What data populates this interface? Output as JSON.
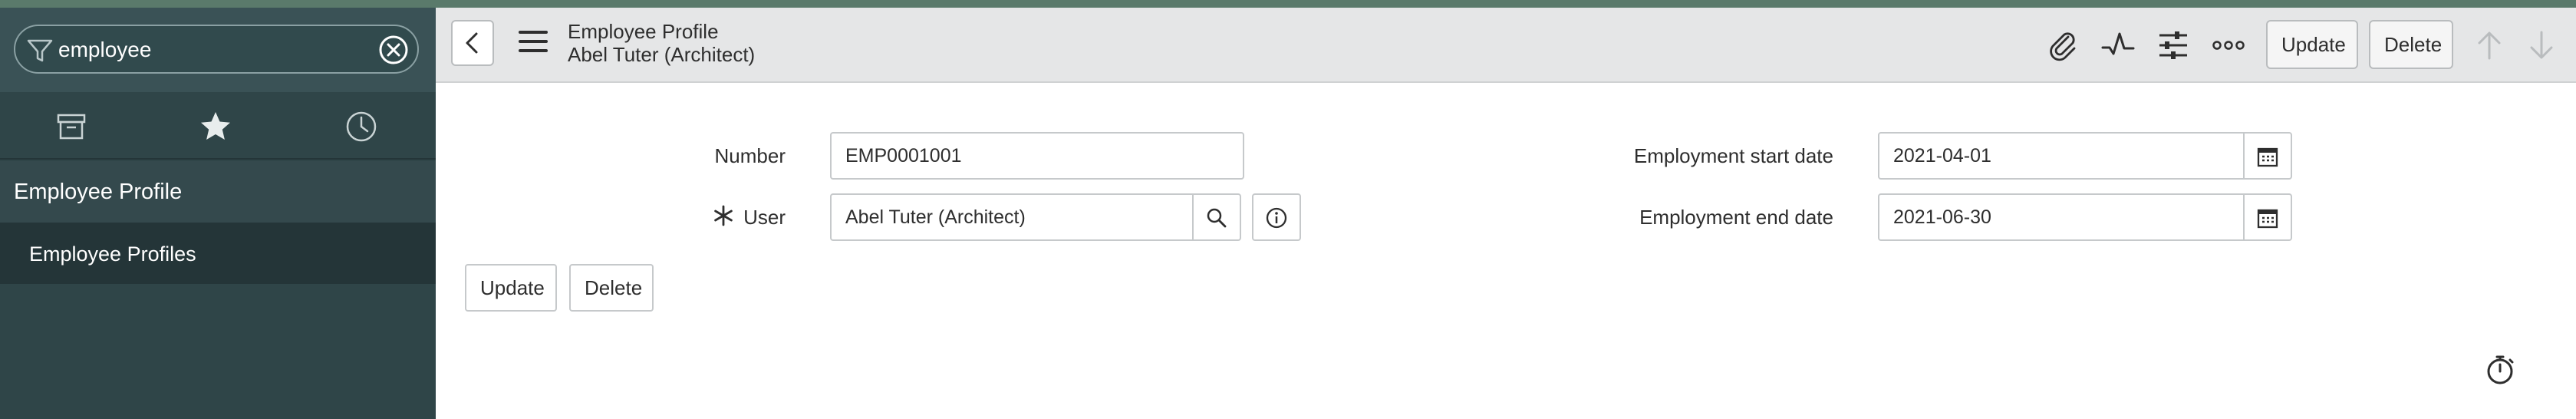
{
  "sidebar": {
    "filter": {
      "value": "employee",
      "icon": "filter-icon",
      "clear_icon": "clear-circle-icon"
    },
    "nav_icons": [
      "archive-icon",
      "star-icon",
      "clock-icon"
    ],
    "heading": "Employee Profile",
    "items": [
      {
        "label": "Employee Profiles"
      }
    ]
  },
  "header": {
    "title": "Employee Profile",
    "subtitle": "Abel Tuter (Architect)",
    "icons": [
      "back-icon",
      "hamburger-icon",
      "attachment-icon",
      "activity-icon",
      "settings-sliders-icon",
      "more-icon",
      "arrow-up-icon",
      "arrow-down-icon"
    ],
    "update_label": "Update",
    "delete_label": "Delete"
  },
  "form": {
    "number": {
      "label": "Number",
      "value": "EMP0001001"
    },
    "user": {
      "label": "User",
      "value": "Abel Tuter (Architect)",
      "required": true
    },
    "start_date": {
      "label": "Employment start date",
      "value": "2021-04-01"
    },
    "end_date": {
      "label": "Employment end date",
      "value": "2021-06-30"
    },
    "update_label": "Update",
    "delete_label": "Delete"
  },
  "colors": {
    "sidebar_bg": "#2f4548",
    "sidebar_active": "#243538",
    "header_bg": "#e5e6e7",
    "top_strip": "#5a7a6b"
  }
}
